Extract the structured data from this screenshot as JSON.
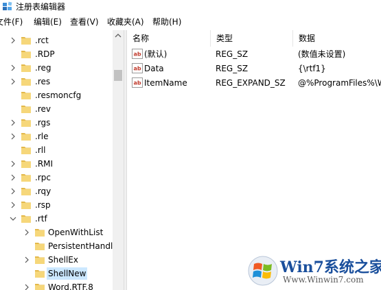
{
  "window": {
    "title": "注册表编辑器"
  },
  "menu": [
    {
      "label": "文件(F)"
    },
    {
      "label": "编辑(E)"
    },
    {
      "label": "查看(V)"
    },
    {
      "label": "收藏夹(A)"
    },
    {
      "label": "帮助(H)"
    }
  ],
  "tree": {
    "items": [
      {
        "label": ".rct",
        "level": 1,
        "state": "collapsed"
      },
      {
        "label": ".RDP",
        "level": 1,
        "state": "none"
      },
      {
        "label": ".reg",
        "level": 1,
        "state": "collapsed"
      },
      {
        "label": ".res",
        "level": 1,
        "state": "collapsed"
      },
      {
        "label": ".resmoncfg",
        "level": 1,
        "state": "none"
      },
      {
        "label": ".rev",
        "level": 1,
        "state": "none"
      },
      {
        "label": ".rgs",
        "level": 1,
        "state": "collapsed"
      },
      {
        "label": ".rle",
        "level": 1,
        "state": "collapsed"
      },
      {
        "label": ".rll",
        "level": 1,
        "state": "none"
      },
      {
        "label": ".RMI",
        "level": 1,
        "state": "collapsed"
      },
      {
        "label": ".rpc",
        "level": 1,
        "state": "collapsed"
      },
      {
        "label": ".rqy",
        "level": 1,
        "state": "collapsed"
      },
      {
        "label": ".rsp",
        "level": 1,
        "state": "collapsed"
      },
      {
        "label": ".rtf",
        "level": 1,
        "state": "expanded"
      },
      {
        "label": "OpenWithList",
        "level": 2,
        "state": "collapsed"
      },
      {
        "label": "PersistentHandler",
        "level": 2,
        "state": "none"
      },
      {
        "label": "ShellEx",
        "level": 2,
        "state": "collapsed"
      },
      {
        "label": "ShellNew",
        "level": 2,
        "state": "none",
        "selected": true
      },
      {
        "label": "Word.RTF.8",
        "level": 2,
        "state": "collapsed"
      }
    ]
  },
  "list": {
    "columns": [
      "名称",
      "类型",
      "数据"
    ],
    "rows": [
      {
        "name": "(默认)",
        "type": "REG_SZ",
        "data": "(数值未设置)",
        "icon": "string-value-icon"
      },
      {
        "name": "Data",
        "type": "REG_SZ",
        "data": "{\\rtf1}",
        "icon": "string-value-icon"
      },
      {
        "name": "ItemName",
        "type": "REG_EXPAND_SZ",
        "data": "@%ProgramFiles%\\W",
        "icon": "string-value-icon"
      }
    ]
  },
  "watermark": {
    "brand": "Win7系统之家",
    "url": "Www.Winwin7.com"
  },
  "colors": {
    "selection": "#cce8ff",
    "folder": "#f6d77a",
    "folder_dark": "#e3b84a",
    "value_icon_red": "#c0392b"
  }
}
